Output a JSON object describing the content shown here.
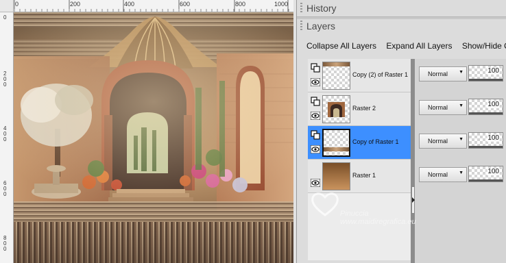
{
  "rulers": {
    "horizontal": [
      "0",
      "200",
      "400",
      "600",
      "800",
      "1000"
    ],
    "vertical": [
      "0",
      "200",
      "400",
      "600",
      "800"
    ]
  },
  "panels": {
    "history_title": "History",
    "layers_title": "Layers"
  },
  "layers_toolbar": {
    "collapse": "Collapse All Layers",
    "expand": "Expand All Layers",
    "show_hide": "Show/Hide Quick"
  },
  "layers": [
    {
      "name": "Copy (2) of Raster 1",
      "blend": "Normal",
      "opacity": "100",
      "selected": false,
      "thumbnail": "transparent-top-strip"
    },
    {
      "name": "Raster 2",
      "blend": "Normal",
      "opacity": "100",
      "selected": false,
      "thumbnail": "arch-image"
    },
    {
      "name": "Copy of Raster 1",
      "blend": "Normal",
      "opacity": "100",
      "selected": true,
      "thumbnail": "transparent-bottom-strip"
    },
    {
      "name": "Raster 1",
      "blend": "Normal",
      "opacity": "100",
      "selected": false,
      "thumbnail": "brown-gradient"
    }
  ],
  "icons": {
    "link": "link-icon",
    "visibility": "eye-icon",
    "dropdown": "chevron-down-icon",
    "splitter": "chevron-right-icon"
  },
  "watermark": {
    "name": "Pinuccia",
    "url": "www.maidiregrafica.eu"
  },
  "colors": {
    "selected_row": "#3d8fff",
    "panel_bg": "#dcdcdc"
  }
}
